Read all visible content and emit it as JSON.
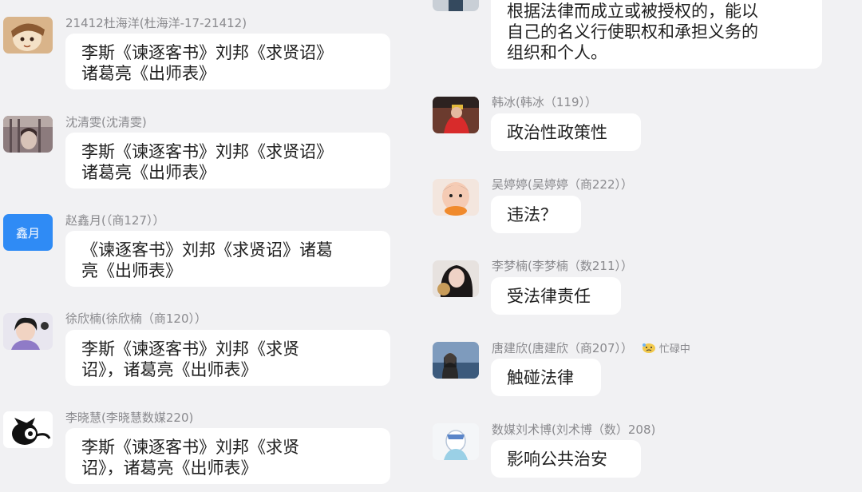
{
  "left_messages": [
    {
      "sender": "21412杜海洋(杜海洋-17-21412)",
      "text_line1": "李斯《谏逐客书》刘邦《求贤诏》",
      "text_line2": "诸葛亮《出师表》"
    },
    {
      "sender": "沈清雯(沈清雯)",
      "text_line1": "李斯《谏逐客书》刘邦《求贤诏》",
      "text_line2": "诸葛亮《出师表》"
    },
    {
      "sender": "赵鑫月(（商127））",
      "avatar_text": "鑫月",
      "avatar_color": "#2f8bf5",
      "text_line1": "《谏逐客书》刘邦《求贤诏》诸葛",
      "text_line2": "亮《出师表》"
    },
    {
      "sender": "徐欣楠(徐欣楠（商120））",
      "text_line1": "李斯《谏逐客书》刘邦《求贤",
      "text_line2": "诏》，诸葛亮《出师表》"
    },
    {
      "sender": "李晓慧(李晓慧数媒220)",
      "text_line1": "李斯《谏逐客书》刘邦《求贤",
      "text_line2": "诏》，诸葛亮《出师表》"
    }
  ],
  "right_messages": [
    {
      "text_line1": "根据法律而成立或被授权的，能以",
      "text_line2": "自己的名义行使职权和承担义务的",
      "text_line3": "组织和个人。"
    },
    {
      "sender": "韩冰(韩冰（119））",
      "text": "政治性政策性"
    },
    {
      "sender": "吴婷婷(吴婷婷（商222））",
      "text": "违法？"
    },
    {
      "sender": "李梦楠(李梦楠（数211））",
      "text": "受法律责任"
    },
    {
      "sender": "唐建欣(唐建欣（商207））",
      "status": "忙碌中",
      "text": "触碰法律"
    },
    {
      "sender": "数媒刘术博(刘术博（数）208)",
      "text": "影响公共治安"
    }
  ],
  "colors": {
    "background": "#f1f1f3",
    "bubble": "#ffffff",
    "name_text": "#8a8a8e",
    "message_text": "#1f1f1f"
  }
}
